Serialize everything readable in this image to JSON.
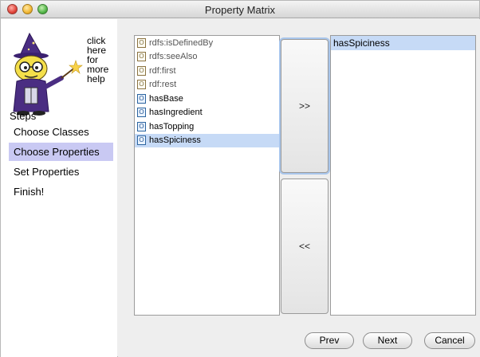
{
  "window": {
    "title": "Property Matrix"
  },
  "help": {
    "text": "click\nhere\nfor\nmore\nhelp"
  },
  "steps": {
    "heading": "Steps",
    "items": [
      {
        "label": "Choose Classes",
        "active": false
      },
      {
        "label": "Choose Properties",
        "active": true
      },
      {
        "label": "Set Properties",
        "active": false
      },
      {
        "label": "Finish!",
        "active": false
      }
    ]
  },
  "available_properties": [
    {
      "label": "rdfs:isDefinedBy",
      "kind": "annotation",
      "selected": false
    },
    {
      "label": "rdfs:seeAlso",
      "kind": "annotation",
      "selected": false
    },
    {
      "label": "rdf:first",
      "kind": "annotation",
      "selected": false
    },
    {
      "label": "rdf:rest",
      "kind": "annotation",
      "selected": false
    },
    {
      "label": "hasBase",
      "kind": "object",
      "selected": false
    },
    {
      "label": "hasIngredient",
      "kind": "object",
      "selected": false
    },
    {
      "label": "hasTopping",
      "kind": "object",
      "selected": false
    },
    {
      "label": "hasSpiciness",
      "kind": "object",
      "selected": true
    }
  ],
  "chosen_properties": [
    "hasSpiciness"
  ],
  "buttons": {
    "add": ">>",
    "remove": "<<",
    "prev": "Prev",
    "next": "Next",
    "cancel": "Cancel"
  },
  "colors": {
    "step_highlight": "#c9c9f3",
    "list_selection": "#c6daf6",
    "wizard_hat": "#4a2d82"
  }
}
